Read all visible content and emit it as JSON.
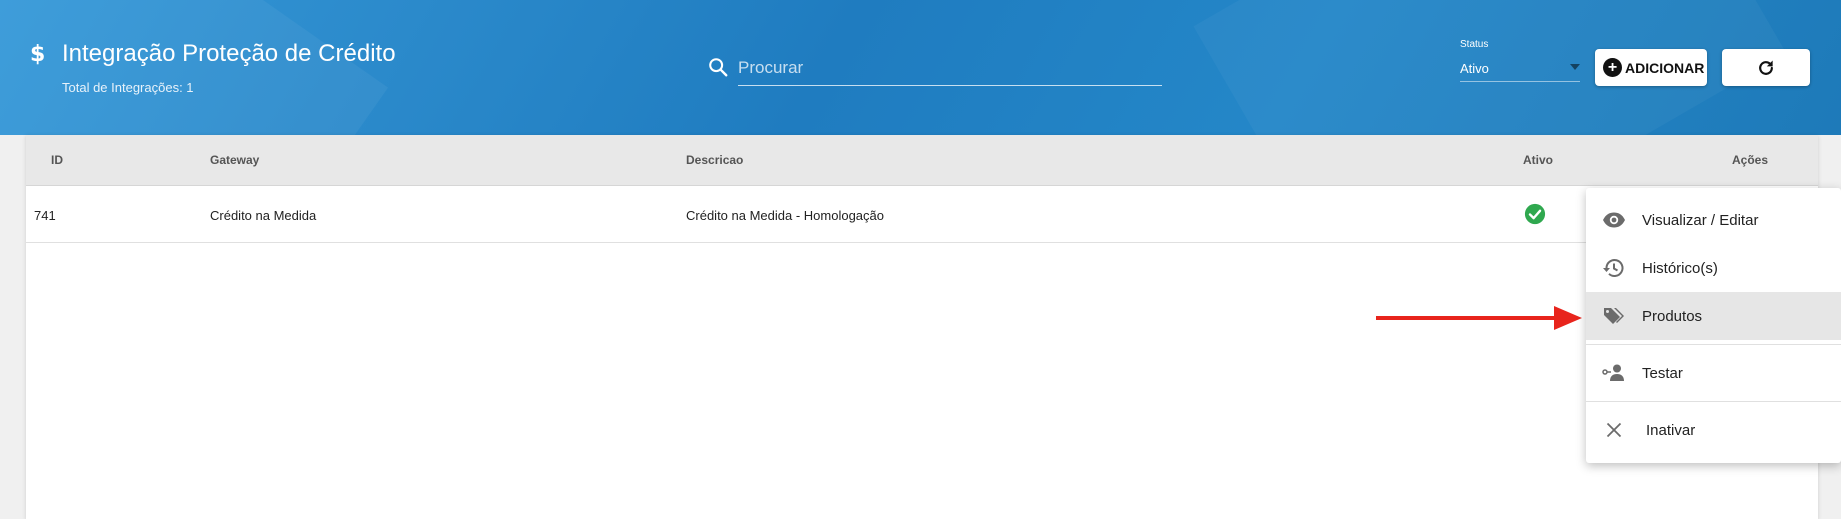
{
  "header": {
    "title": "Integração Proteção de Crédito",
    "subtitle": "Total de Integrações: 1",
    "icon": "dollar-icon",
    "dollar_glyph": "$",
    "search": {
      "placeholder": "Procurar",
      "value": ""
    },
    "status": {
      "label": "Status",
      "value": "Ativo"
    },
    "add_button": {
      "label": "ADICIONAR"
    },
    "refresh_button": {
      "icon": "refresh-icon"
    }
  },
  "table": {
    "columns": [
      "ID",
      "Gateway",
      "Descricao",
      "Ativo",
      "Ações"
    ],
    "rows": [
      {
        "id": "741",
        "gateway": "Crédito na Medida",
        "descricao": "Crédito na Medida - Homologação",
        "ativo": true
      }
    ]
  },
  "menu": {
    "items": [
      {
        "label": "Visualizar / Editar",
        "icon": "eye-icon"
      },
      {
        "label": "Histórico(s)",
        "icon": "history-icon"
      },
      {
        "label": "Produtos",
        "icon": "tags-icon",
        "highlighted": true
      },
      {
        "label": "Testar",
        "icon": "test-user-icon"
      },
      {
        "label": "Inativar",
        "icon": "close-icon"
      }
    ]
  },
  "colors": {
    "header_bg": "#1f7cc0",
    "check_green": "#2fa84f",
    "arrow_red": "#e8241c"
  }
}
